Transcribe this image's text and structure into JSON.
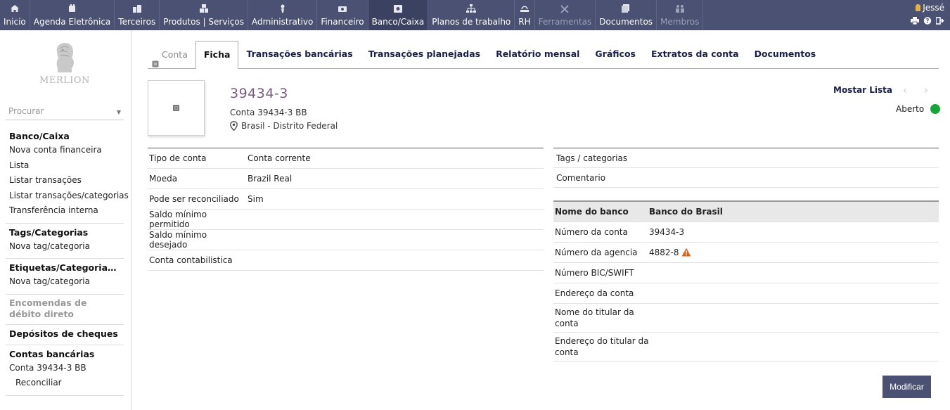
{
  "topnav": [
    {
      "label": "Inicio",
      "icon": "home-icon",
      "state": "normal"
    },
    {
      "label": "Agenda Eletrônica",
      "icon": "agenda-icon",
      "state": "normal"
    },
    {
      "label": "Terceiros",
      "icon": "buildings-icon",
      "state": "normal"
    },
    {
      "label": "Produtos | Serviços",
      "icon": "boxes-icon",
      "state": "normal"
    },
    {
      "label": "Administrativo",
      "icon": "admin-icon",
      "state": "normal"
    },
    {
      "label": "Financeiro",
      "icon": "money-icon",
      "state": "normal"
    },
    {
      "label": "Banco/Caixa",
      "icon": "safe-icon",
      "state": "active"
    },
    {
      "label": "Planos de trabalho",
      "icon": "sitemap-icon",
      "state": "normal"
    },
    {
      "label": "RH",
      "icon": "hr-icon",
      "state": "normal"
    },
    {
      "label": "Ferramentas",
      "icon": "tools-icon",
      "state": "dim"
    },
    {
      "label": "Documentos",
      "icon": "documents-icon",
      "state": "normal"
    },
    {
      "label": "Membros",
      "icon": "members-icon",
      "state": "dim"
    }
  ],
  "user": {
    "name": "Jessé"
  },
  "logo": {
    "text": "MERLION"
  },
  "search": {
    "placeholder": "Procurar"
  },
  "sidebar": {
    "sections": [
      {
        "header": "Banco/Caixa",
        "dim": false,
        "items": [
          {
            "label": "Nova conta financeira",
            "sub": false
          },
          {
            "label": "Lista",
            "sub": false
          },
          {
            "label": "Listar transações",
            "sub": false
          },
          {
            "label": "Listar transações/categorias",
            "sub": false
          },
          {
            "label": "Transferência interna",
            "sub": false
          }
        ]
      },
      {
        "header": "Tags/Categorias",
        "dim": false,
        "items": [
          {
            "label": "Nova tag/categoria",
            "sub": false
          }
        ]
      },
      {
        "header": "Etiquetas/Categorias de...",
        "dim": false,
        "items": [
          {
            "label": "Nova tag/categoria",
            "sub": false
          }
        ]
      },
      {
        "header": "Encomendas de débito direto",
        "dim": true,
        "items": []
      },
      {
        "header": "Depósitos de cheques",
        "dim": false,
        "items": []
      },
      {
        "header": "Contas bancárias",
        "dim": false,
        "items": [
          {
            "label": "Conta 39434-3 BB",
            "sub": false
          },
          {
            "label": "Reconciliar",
            "sub": true
          }
        ]
      }
    ]
  },
  "tabs": [
    {
      "label": "Conta",
      "kind": "first"
    },
    {
      "label": "Ficha",
      "kind": "active"
    },
    {
      "label": "Transações bancárias",
      "kind": "normal"
    },
    {
      "label": "Transações planejadas",
      "kind": "normal"
    },
    {
      "label": "Relatório mensal",
      "kind": "normal"
    },
    {
      "label": "Gráficos",
      "kind": "normal"
    },
    {
      "label": "Extratos da conta",
      "kind": "normal"
    },
    {
      "label": "Documentos",
      "kind": "normal"
    }
  ],
  "account": {
    "ref": "39434-3",
    "label": "Conta 39434-3 BB",
    "location": "Brasil - Distrito Federal",
    "show_list": "Mostar Lista",
    "status": "Aberto",
    "status_color": "#1aa53a"
  },
  "left_fields": [
    {
      "label": "Tipo de conta",
      "value": "Conta corrente"
    },
    {
      "label": "Moeda",
      "value": "Brazil Real"
    },
    {
      "label": "Pode ser reconciliado",
      "value": "Sim"
    },
    {
      "label": "Saldo mínimo permitido",
      "value": ""
    },
    {
      "label": "Saldo mínimo desejado",
      "value": ""
    },
    {
      "label": "Conta contabilistica",
      "value": ""
    }
  ],
  "right_fields": [
    {
      "label": "Tags / categorias"
    },
    {
      "label": "Comentario"
    },
    {
      "label": ""
    }
  ],
  "bank": {
    "header_label": "Nome do banco",
    "header_value": "Banco do Brasil",
    "rows": [
      {
        "label": "Número da conta",
        "value": "39434-3",
        "warn": false,
        "two": false
      },
      {
        "label": "Número da agencia",
        "value": "4882-8",
        "warn": true,
        "two": false
      },
      {
        "label": "Número BIC/SWIFT",
        "value": "",
        "warn": false,
        "two": false
      },
      {
        "label": "Endereço da conta",
        "value": "",
        "warn": false,
        "two": false
      },
      {
        "label": "Nome do titular da conta",
        "value": "",
        "warn": false,
        "two": true
      },
      {
        "label": "Endereço do titular da conta",
        "value": "",
        "warn": false,
        "two": true
      }
    ]
  },
  "actions": {
    "modify": "Modificar"
  },
  "colors": {
    "topbar": "#4a5172",
    "accent_title": "#7a5a7e",
    "warning": "#d9661f"
  }
}
